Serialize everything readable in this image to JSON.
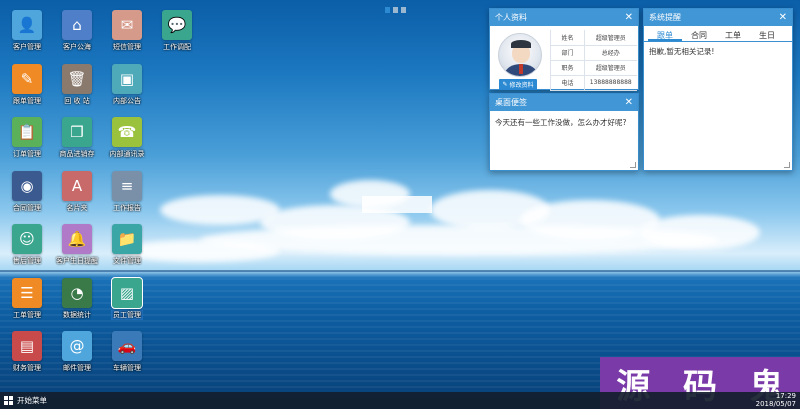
{
  "desktop": {
    "icons": [
      {
        "label": "客户管理",
        "icon": "user-card-icon",
        "color": "#4ea6dc"
      },
      {
        "label": "客户公海",
        "icon": "customer-sea-icon",
        "color": "#4e7fc8"
      },
      {
        "label": "短信管理",
        "icon": "envelope-icon",
        "color": "#d69a8a"
      },
      {
        "label": "工作调配",
        "icon": "chat-icon",
        "color": "#3aa68e"
      },
      {
        "label": "跟单管理",
        "icon": "edit-icon",
        "color": "#f08a24"
      },
      {
        "label": "回 收 站",
        "icon": "trash-icon",
        "color": "#8a7a6e"
      },
      {
        "label": "内部公告",
        "icon": "briefcase-icon",
        "color": "#4eaab8"
      },
      {
        "label": "订单管理",
        "icon": "clipboard-icon",
        "color": "#5bb05a"
      },
      {
        "label": "商品进销存",
        "icon": "boxes-icon",
        "color": "#3aa68e"
      },
      {
        "label": "内部通讯录",
        "icon": "address-book-icon",
        "color": "#9bc23c"
      },
      {
        "label": "合同管理",
        "icon": "contract-icon",
        "color": "#3a5a90"
      },
      {
        "label": "名片夹",
        "icon": "business-card-icon",
        "color": "#c96a6a"
      },
      {
        "label": "工作报告",
        "icon": "report-icon",
        "color": "#7a90a8"
      },
      {
        "label": "售后管理",
        "icon": "support-agent-icon",
        "color": "#3aa68e"
      },
      {
        "label": "客户生日提醒",
        "icon": "bell-icon",
        "color": "#b07ac8"
      },
      {
        "label": "文件管理",
        "icon": "folder-icon",
        "color": "#3aa6a6"
      },
      {
        "label": "工单管理",
        "icon": "list-icon",
        "color": "#f08a24"
      },
      {
        "label": "数据统计",
        "icon": "pie-chart-icon",
        "color": "#3a7a48"
      },
      {
        "label": "员工管理",
        "icon": "employee-icon",
        "color": "#3aa68e"
      },
      {
        "label": "财务管理",
        "icon": "wallet-icon",
        "color": "#c84a4a"
      },
      {
        "label": "邮件管理",
        "icon": "at-icon",
        "color": "#4ea6dc"
      },
      {
        "label": "车辆管理",
        "icon": "car-icon",
        "color": "#3a7ab8"
      }
    ]
  },
  "profile_window": {
    "title": "个人资料",
    "edit_label": "修改资料",
    "rows": [
      {
        "key": "姓名",
        "value": "超级管理员"
      },
      {
        "key": "部门",
        "value": "总经办"
      },
      {
        "key": "职务",
        "value": "超级管理员"
      },
      {
        "key": "电话",
        "value": "13888888888"
      }
    ]
  },
  "note_window": {
    "title": "桌面便签",
    "text": "今天还有一些工作没做，怎么办才好呢?"
  },
  "reminder_window": {
    "title": "系统提醒",
    "tabs": [
      "跟单",
      "合同",
      "工单",
      "生日"
    ],
    "message": "抱歉,暂无相关记录!"
  },
  "taskbar": {
    "start_label": "开始菜单",
    "time": "17:29",
    "date": "2018/05/07"
  },
  "watermark": {
    "chars": [
      "源",
      "码",
      "鬼"
    ]
  }
}
